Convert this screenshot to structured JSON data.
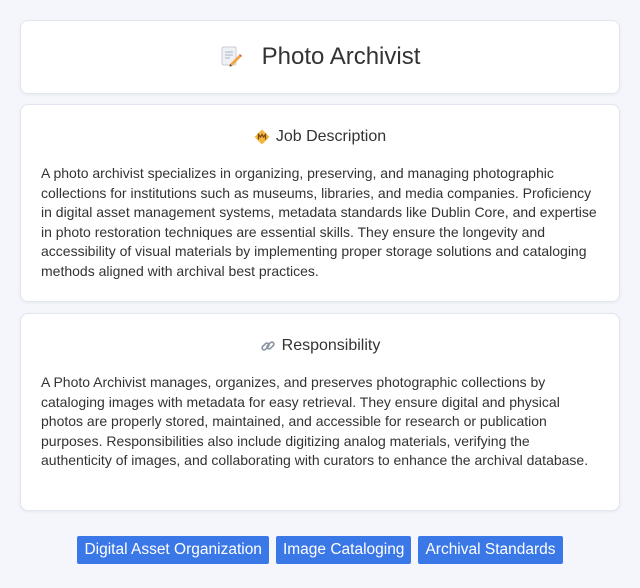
{
  "header": {
    "title": "Photo Archivist",
    "icon": "memo-pencil-icon"
  },
  "job_description": {
    "heading": "Job Description",
    "icon": "diamond-badge-icon",
    "text": "A photo archivist specializes in organizing, preserving, and managing photographic collections for institutions such as museums, libraries, and media companies. Proficiency in digital asset management systems, metadata standards like Dublin Core, and expertise in photo restoration techniques are essential skills. They ensure the longevity and accessibility of visual materials by implementing proper storage solutions and cataloging methods aligned with archival best practices."
  },
  "responsibility": {
    "heading": "Responsibility",
    "icon": "link-icon",
    "text": "A Photo Archivist manages, organizes, and preserves photographic collections by cataloging images with metadata for easy retrieval. They ensure digital and physical photos are properly stored, maintained, and accessible for research or publication purposes. Responsibilities also include digitizing analog materials, verifying the authenticity of images, and collaborating with curators to enhance the archival database."
  },
  "tags": [
    "Digital Asset Organization",
    "Image Cataloging",
    "Archival Standards"
  ],
  "colors": {
    "tag_bg": "#3b78e7",
    "page_bg": "#f4f6fb",
    "card_bg": "#ffffff"
  }
}
